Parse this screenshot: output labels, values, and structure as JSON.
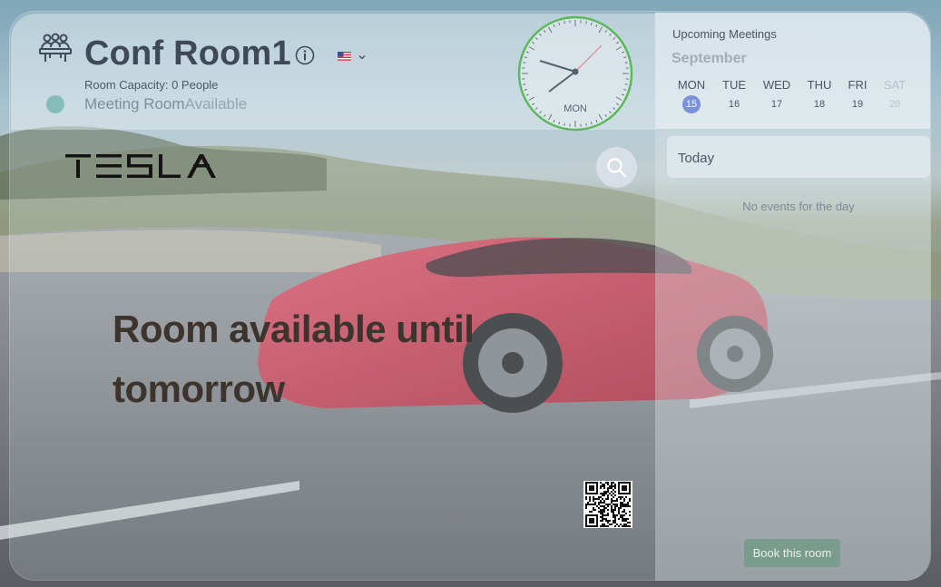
{
  "room": {
    "name": "Conf Room1",
    "capacity_text": "Room Capacity: 0 People",
    "type_label": "Meeting Room",
    "status_label": "Available"
  },
  "clock": {
    "day_label": "MON"
  },
  "brand": {
    "name": "TESLA"
  },
  "headline": "Room available until tomorrow",
  "calendar": {
    "title": "Upcoming Meetings",
    "month": "September",
    "days": [
      {
        "name": "MON",
        "num": "15",
        "selected": true
      },
      {
        "name": "TUE",
        "num": "16"
      },
      {
        "name": "WED",
        "num": "17"
      },
      {
        "name": "THU",
        "num": "18"
      },
      {
        "name": "FRI",
        "num": "19"
      },
      {
        "name": "SAT",
        "num": "20",
        "weekend": true
      }
    ]
  },
  "agenda": {
    "today_label": "Today",
    "empty_text": "No events for the day"
  },
  "actions": {
    "book_label": "Book this room"
  },
  "colors": {
    "status_available": "#6fb3a9",
    "selected_day": "#7b93d6",
    "book_button": "#7a9c8e",
    "clock_ring": "#5cb85c"
  },
  "icons": {
    "room": "meeting-table-icon",
    "info": "info-icon",
    "language": "us-flag-icon",
    "search": "search-icon"
  }
}
